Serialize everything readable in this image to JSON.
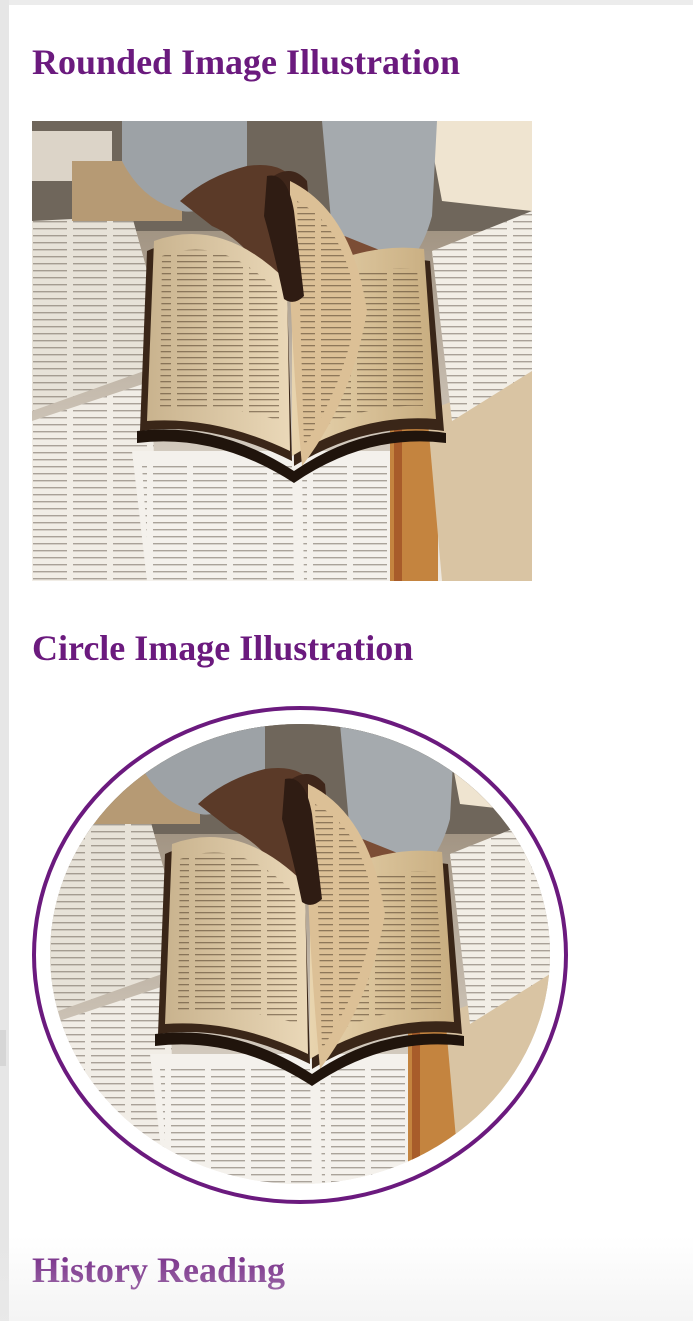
{
  "sections": [
    {
      "heading": "Rounded Image Illustration",
      "image": "open-book-photo"
    },
    {
      "heading": "Circle Image Illustration",
      "image": "open-book-photo-circle"
    },
    {
      "heading": "History Reading"
    }
  ],
  "colors": {
    "heading": "#6b1a7e",
    "circle_border": "#6b1a7e",
    "background": "#ffffff"
  }
}
